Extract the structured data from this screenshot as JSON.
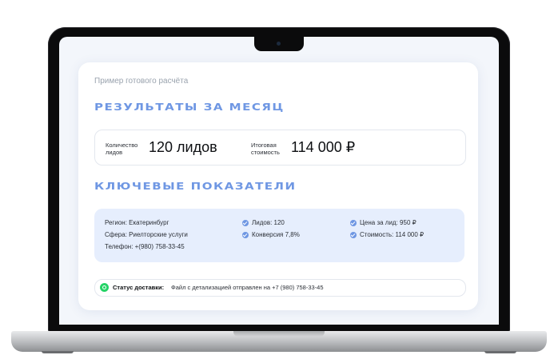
{
  "card": {
    "caption": "Пример готового расчёта",
    "results_title": "РЕЗУЛЬТАТЫ ЗА МЕСЯЦ",
    "leads_label": "Количество лидов",
    "leads_value": "120 лидов",
    "cost_label": "Итоговая стоимость",
    "cost_value": "114 000 ₽",
    "kpi_title": "КЛЮЧЕВЫЕ ПОКАЗАТЕЛИ",
    "kpi": {
      "region": "Регион: Екатеринбург",
      "sphere": "Сфера: Риелторские услуги",
      "phone": "Телефон: +(980) 758-33-45",
      "leads": "Лидов: 120",
      "conversion": "Конверсия 7,8%",
      "lead_price": "Цена за лид: 950 ₽",
      "total_cost": "Стоимость: 114 000 ₽"
    },
    "status_label": "Статус доставки:",
    "status_text": "Файл с детализацией отправлен на +7 (980) 758-33-45"
  },
  "icons": [
    "check-icon",
    "whatsapp-icon",
    "camera-icon"
  ],
  "colors": {
    "accent": "#6f97e3",
    "kpi_background": "#e6eefd",
    "whatsapp": "#25d366"
  }
}
